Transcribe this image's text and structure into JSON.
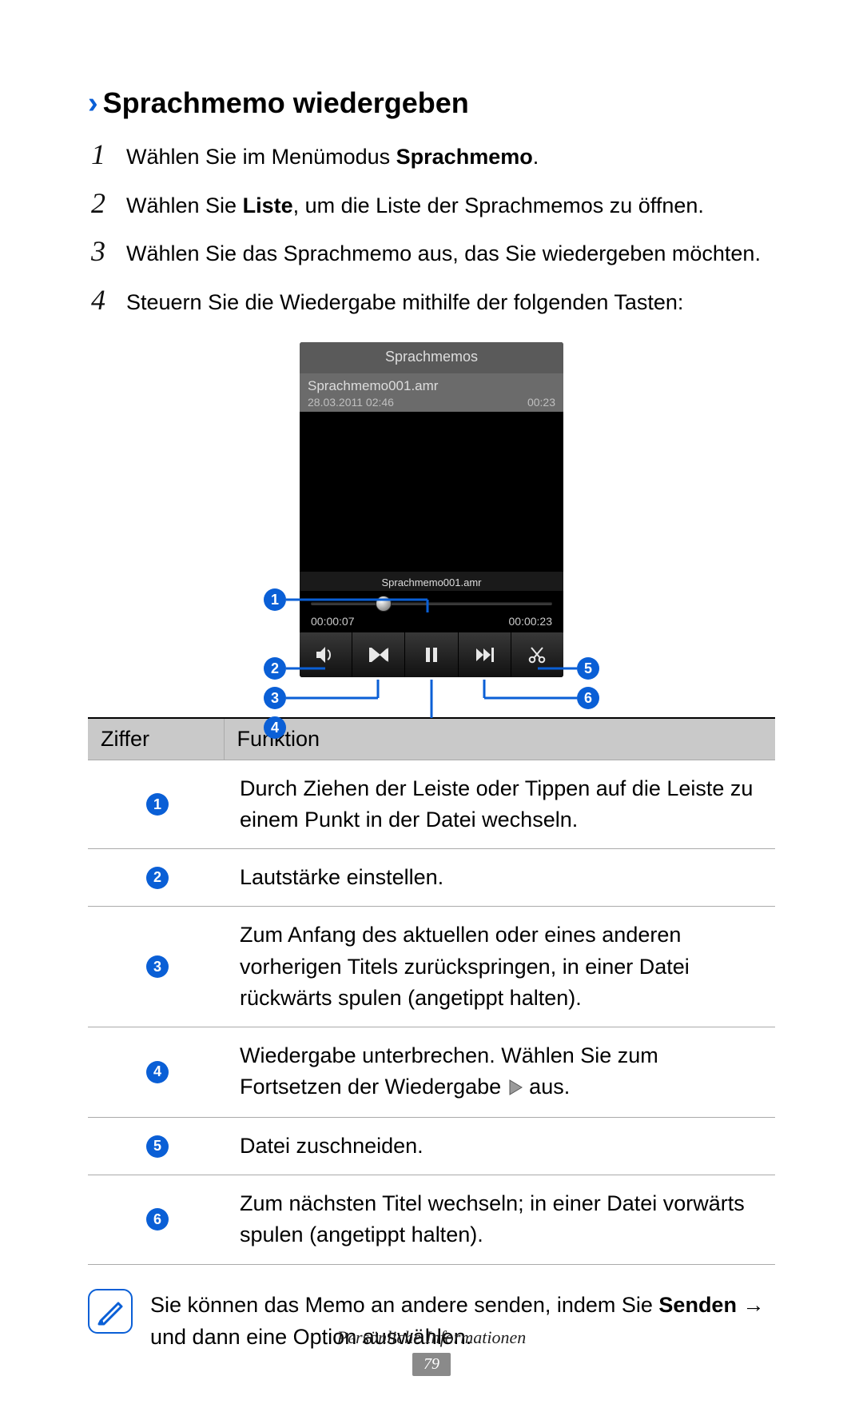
{
  "heading": "Sprachmemo wiedergeben",
  "steps": {
    "s1_pre": "Wählen Sie im Menümodus ",
    "s1_b": "Sprachmemo",
    "s1_post": ".",
    "s2_pre": "Wählen Sie ",
    "s2_b": "Liste",
    "s2_post": ", um die Liste der Sprachmemos zu öffnen.",
    "s3": "Wählen Sie das Sprachmemo aus, das Sie wiedergeben möchten.",
    "s4": "Steuern Sie die Wiedergabe mithilfe der folgenden Tasten:"
  },
  "device": {
    "title": "Sprachmemos",
    "file_name": "Sprachmemo001.amr",
    "file_date": "28.03.2011 02:46",
    "file_dur": "00:23",
    "now_playing": "Sprachmemo001.amr",
    "elapsed": "00:00:07",
    "total": "00:00:23"
  },
  "callouts": {
    "n1": "1",
    "n2": "2",
    "n3": "3",
    "n4": "4",
    "n5": "5",
    "n6": "6"
  },
  "table": {
    "col_z": "Ziffer",
    "col_f": "Funktion",
    "r1": "Durch Ziehen der Leiste oder Tippen auf die Leiste zu einem Punkt in der Datei wechseln.",
    "r2": "Lautstärke einstellen.",
    "r3": "Zum Anfang des aktuellen oder eines anderen vorherigen Titels zurückspringen, in einer Datei rückwärts spulen (angetippt halten).",
    "r4_pre": "Wiedergabe unterbrechen. Wählen Sie zum Fortsetzen der Wiedergabe ",
    "r4_post": " aus.",
    "r5": "Datei zuschneiden.",
    "r6": "Zum nächsten Titel wechseln; in einer Datei vorwärts spulen (angetippt halten)."
  },
  "note": {
    "pre": "Sie können das Memo an andere senden, indem Sie ",
    "b": "Senden",
    "arrow": " → ",
    "post": "und dann eine Option auswählen."
  },
  "footer": {
    "section": "Persönliche Informationen",
    "page": "79"
  }
}
